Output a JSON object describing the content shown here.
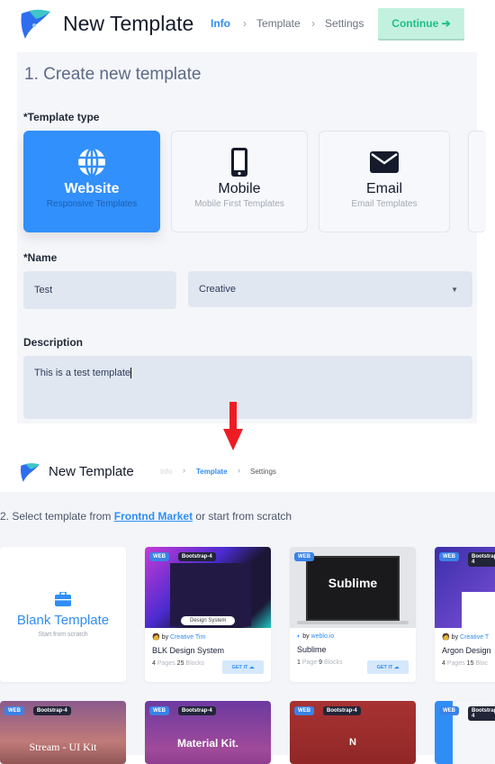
{
  "step1": {
    "header": {
      "title": "New Template",
      "crumbs": [
        "Info",
        "Template",
        "Settings"
      ],
      "continue_label": "Continue"
    },
    "section_title": "1. Create new template",
    "type_label": "*Template type",
    "types": [
      {
        "name": "Website",
        "sub": "Responsive Templates",
        "icon": "globe-icon",
        "selected": true
      },
      {
        "name": "Mobile",
        "sub": "Mobile First Templates",
        "icon": "mobile-icon"
      },
      {
        "name": "Email",
        "sub": "Email Templates",
        "icon": "envelope-icon"
      }
    ],
    "name_label": "*Name",
    "name_value": "Test",
    "category_value": "Creative",
    "description_label": "Description",
    "description_value": "This is a test template"
  },
  "step2": {
    "header": {
      "title": "New Template",
      "crumbs": [
        "Info",
        "Template",
        "Settings"
      ]
    },
    "section_prefix": "2. Select template from ",
    "market_link": "Frontnd Market",
    "section_suffix": " or start from scratch",
    "blank": {
      "title": "Blank Template",
      "sub": "Start from scratch"
    },
    "templates": [
      {
        "badges": [
          "WEB",
          "Bootstrap-4"
        ],
        "by": "by",
        "author": "Creative Tim",
        "name": "BLK Design System",
        "pages": "4",
        "pages_label": "Pages",
        "blocks": "25",
        "blocks_label": "Blocks",
        "get": "GET IT",
        "thumb_text": "Design System"
      },
      {
        "badges": [
          "WEB"
        ],
        "by": "by",
        "author": "weblo.io",
        "name": "Sublime",
        "pages": "1",
        "pages_label": "Page",
        "blocks": "9",
        "blocks_label": "Blocks",
        "get": "GET IT",
        "thumb_text": "Sublime"
      },
      {
        "badges": [
          "WEB",
          "Bootstrap-4"
        ],
        "by": "by",
        "author": "Creative T",
        "name": "Argon Design",
        "pages": "4",
        "pages_label": "Pages",
        "blocks": "15",
        "blocks_label": "Bloc"
      }
    ],
    "row2": [
      {
        "badges": [
          "WEB",
          "Bootstrap-4"
        ],
        "thumb_text": "Stream - UI Kit"
      },
      {
        "badges": [
          "WEB",
          "Bootstrap-4"
        ],
        "thumb_text": "Material Kit."
      },
      {
        "badges": [
          "WEB",
          "Bootstrap-4"
        ],
        "thumb_text": "N"
      },
      {
        "badges": [
          "WEB",
          "Bootstrap-4"
        ]
      }
    ]
  },
  "colors": {
    "accent": "#3190fb",
    "continue_bg": "#c4f1df",
    "arrow": "#ed1c24"
  }
}
